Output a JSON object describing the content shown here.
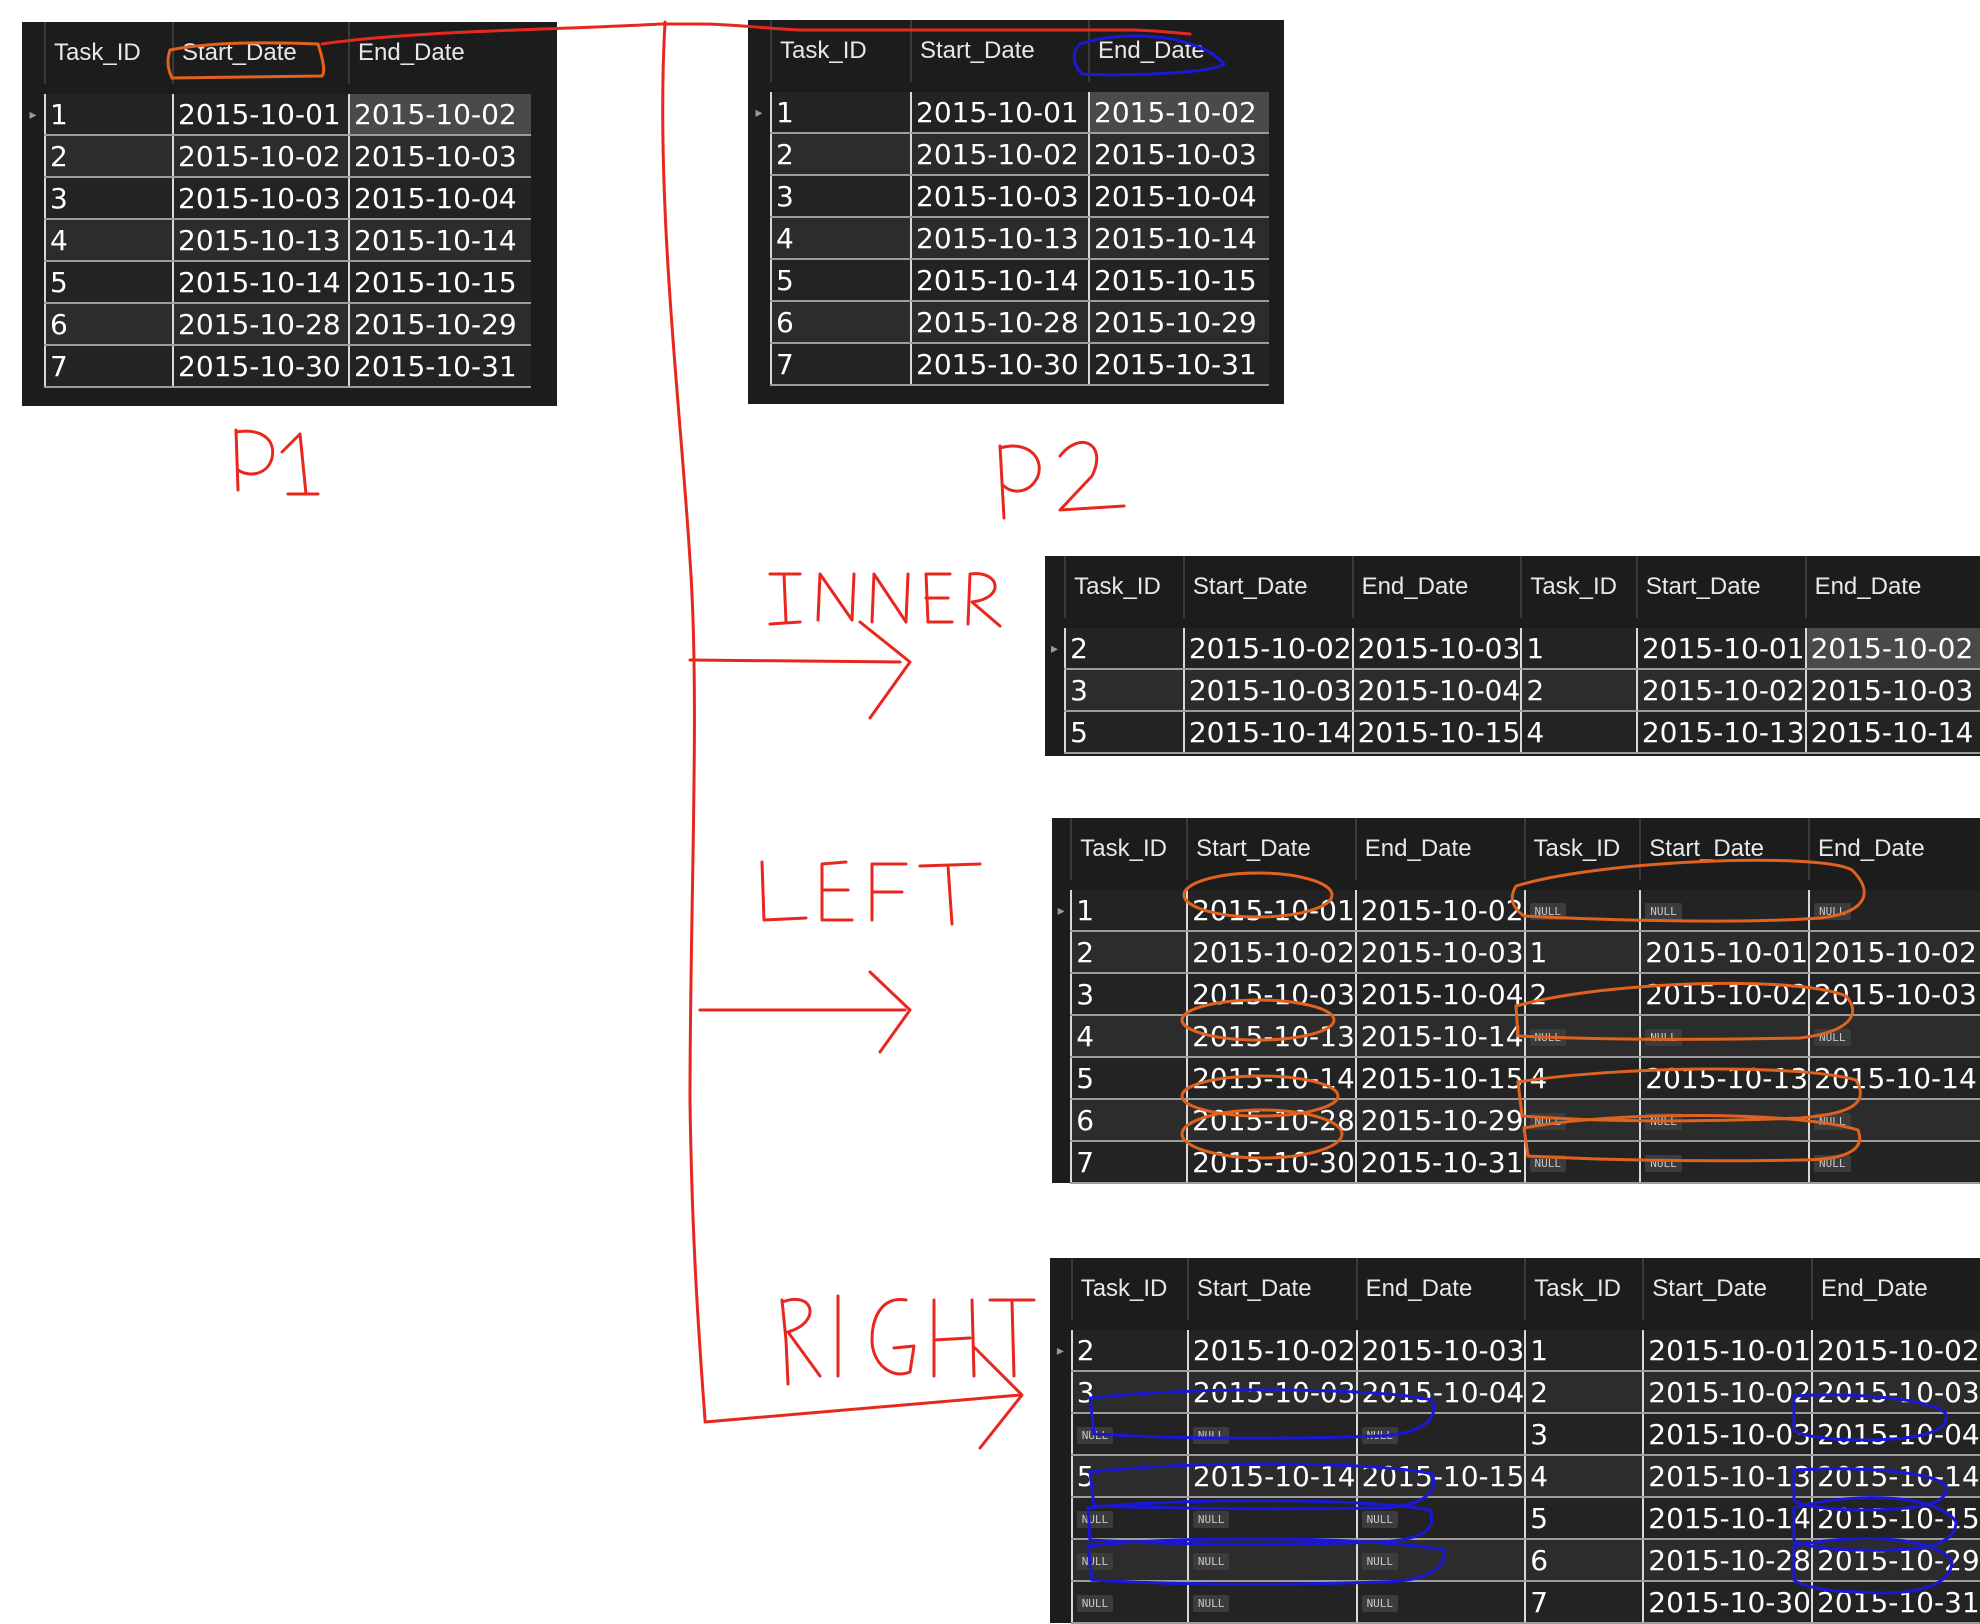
{
  "colors": {
    "annotation_red": "#e8281e",
    "annotation_orange": "#e0621e",
    "annotation_blue": "#1a18d6",
    "grid_bg": "#1c1c1c"
  },
  "labels": {
    "p1": "P1",
    "p2": "P2",
    "inner": "INNER",
    "left": "LEFT",
    "right": "RIGHT"
  },
  "tables": {
    "p1": {
      "columns": [
        "Task_ID",
        "Start_Date",
        "End_Date"
      ],
      "rows": [
        [
          "1",
          "2015-10-01",
          "2015-10-02"
        ],
        [
          "2",
          "2015-10-02",
          "2015-10-03"
        ],
        [
          "3",
          "2015-10-03",
          "2015-10-04"
        ],
        [
          "4",
          "2015-10-13",
          "2015-10-14"
        ],
        [
          "5",
          "2015-10-14",
          "2015-10-15"
        ],
        [
          "6",
          "2015-10-28",
          "2015-10-29"
        ],
        [
          "7",
          "2015-10-30",
          "2015-10-31"
        ]
      ]
    },
    "p2": {
      "columns": [
        "Task_ID",
        "Start_Date",
        "End_Date"
      ],
      "rows": [
        [
          "1",
          "2015-10-01",
          "2015-10-02"
        ],
        [
          "2",
          "2015-10-02",
          "2015-10-03"
        ],
        [
          "3",
          "2015-10-03",
          "2015-10-04"
        ],
        [
          "4",
          "2015-10-13",
          "2015-10-14"
        ],
        [
          "5",
          "2015-10-14",
          "2015-10-15"
        ],
        [
          "6",
          "2015-10-28",
          "2015-10-29"
        ],
        [
          "7",
          "2015-10-30",
          "2015-10-31"
        ]
      ]
    },
    "inner": {
      "columns": [
        "Task_ID",
        "Start_Date",
        "End_Date",
        "Task_ID",
        "Start_Date",
        "End_Date"
      ],
      "rows": [
        [
          "2",
          "2015-10-02",
          "2015-10-03",
          "1",
          "2015-10-01",
          "2015-10-02"
        ],
        [
          "3",
          "2015-10-03",
          "2015-10-04",
          "2",
          "2015-10-02",
          "2015-10-03"
        ],
        [
          "5",
          "2015-10-14",
          "2015-10-15",
          "4",
          "2015-10-13",
          "2015-10-14"
        ]
      ]
    },
    "left": {
      "columns": [
        "Task_ID",
        "Start_Date",
        "End_Date",
        "Task_ID",
        "Start_Date",
        "End_Date"
      ],
      "rows": [
        [
          "1",
          "2015-10-01",
          "2015-10-02",
          "NULL",
          "NULL",
          "NULL"
        ],
        [
          "2",
          "2015-10-02",
          "2015-10-03",
          "1",
          "2015-10-01",
          "2015-10-02"
        ],
        [
          "3",
          "2015-10-03",
          "2015-10-04",
          "2",
          "2015-10-02",
          "2015-10-03"
        ],
        [
          "4",
          "2015-10-13",
          "2015-10-14",
          "NULL",
          "NULL",
          "NULL"
        ],
        [
          "5",
          "2015-10-14",
          "2015-10-15",
          "4",
          "2015-10-13",
          "2015-10-14"
        ],
        [
          "6",
          "2015-10-28",
          "2015-10-29",
          "NULL",
          "NULL",
          "NULL"
        ],
        [
          "7",
          "2015-10-30",
          "2015-10-31",
          "NULL",
          "NULL",
          "NULL"
        ]
      ]
    },
    "right": {
      "columns": [
        "Task_ID",
        "Start_Date",
        "End_Date",
        "Task_ID",
        "Start_Date",
        "End_Date"
      ],
      "rows": [
        [
          "2",
          "2015-10-02",
          "2015-10-03",
          "1",
          "2015-10-01",
          "2015-10-02"
        ],
        [
          "3",
          "2015-10-03",
          "2015-10-04",
          "2",
          "2015-10-02",
          "2015-10-03"
        ],
        [
          "NULL",
          "NULL",
          "NULL",
          "3",
          "2015-10-03",
          "2015-10-04"
        ],
        [
          "5",
          "2015-10-14",
          "2015-10-15",
          "4",
          "2015-10-13",
          "2015-10-14"
        ],
        [
          "NULL",
          "NULL",
          "NULL",
          "5",
          "2015-10-14",
          "2015-10-15"
        ],
        [
          "NULL",
          "NULL",
          "NULL",
          "6",
          "2015-10-28",
          "2015-10-29"
        ],
        [
          "NULL",
          "NULL",
          "NULL",
          "7",
          "2015-10-30",
          "2015-10-31"
        ]
      ]
    }
  }
}
